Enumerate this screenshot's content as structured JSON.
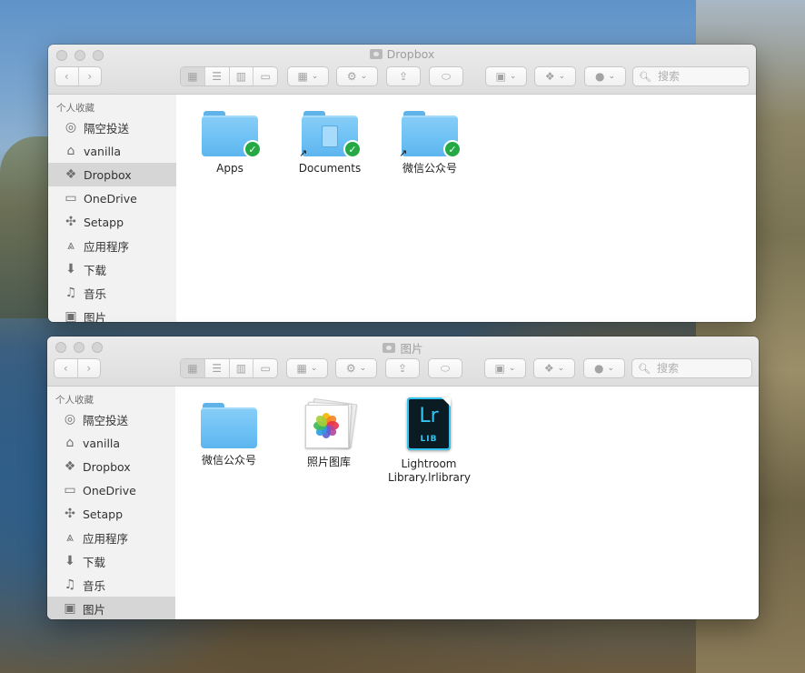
{
  "windows": [
    {
      "title": "Dropbox",
      "search_placeholder": "搜索",
      "sidebar": {
        "section": "个人收藏",
        "items": [
          {
            "label": "隔空投送",
            "icon": "airdrop-icon",
            "selected": false
          },
          {
            "label": "vanilla",
            "icon": "home-icon",
            "selected": false
          },
          {
            "label": "Dropbox",
            "icon": "dropbox-icon",
            "selected": true
          },
          {
            "label": "OneDrive",
            "icon": "folder-icon",
            "selected": false
          },
          {
            "label": "Setapp",
            "icon": "setapp-icon",
            "selected": false
          },
          {
            "label": "应用程序",
            "icon": "applications-icon",
            "selected": false
          },
          {
            "label": "下载",
            "icon": "download-icon",
            "selected": false
          },
          {
            "label": "音乐",
            "icon": "music-icon",
            "selected": false
          },
          {
            "label": "图片",
            "icon": "camera-icon",
            "selected": false
          }
        ]
      },
      "files": [
        {
          "name": "Apps",
          "kind": "folder",
          "synced": true,
          "alias": false
        },
        {
          "name": "Documents",
          "kind": "folder-document",
          "synced": true,
          "alias": true
        },
        {
          "name": "微信公众号",
          "kind": "folder",
          "synced": true,
          "alias": true
        }
      ]
    },
    {
      "title": "图片",
      "search_placeholder": "搜索",
      "sidebar": {
        "section": "个人收藏",
        "items": [
          {
            "label": "隔空投送",
            "icon": "airdrop-icon",
            "selected": false
          },
          {
            "label": "vanilla",
            "icon": "home-icon",
            "selected": false
          },
          {
            "label": "Dropbox",
            "icon": "dropbox-icon",
            "selected": false
          },
          {
            "label": "OneDrive",
            "icon": "folder-icon",
            "selected": false
          },
          {
            "label": "Setapp",
            "icon": "setapp-icon",
            "selected": false
          },
          {
            "label": "应用程序",
            "icon": "applications-icon",
            "selected": false
          },
          {
            "label": "下载",
            "icon": "download-icon",
            "selected": false
          },
          {
            "label": "音乐",
            "icon": "music-icon",
            "selected": false
          },
          {
            "label": "图片",
            "icon": "camera-icon",
            "selected": true
          }
        ]
      },
      "files": [
        {
          "name": "微信公众号",
          "kind": "folder"
        },
        {
          "name": "照片图库",
          "kind": "photos-library"
        },
        {
          "name": "Lightroom Library.lrlibrary",
          "kind": "lightroom-library",
          "icon_text": "Lr",
          "icon_subtext": "LIB"
        }
      ]
    }
  ],
  "colors": {
    "sync_badge": "#26a944",
    "folder_blue": "#6cc0f4",
    "sidebar_selected": "#d6d6d6",
    "lightroom_accent": "#34c4f2"
  }
}
